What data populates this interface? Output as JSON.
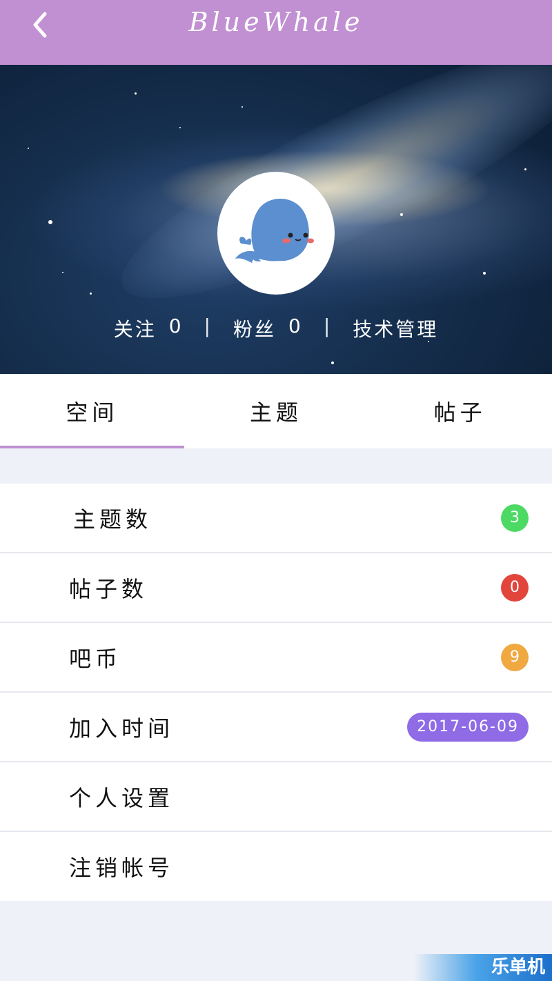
{
  "header": {
    "title": "BlueWhale",
    "back_icon": "chevron-left-icon"
  },
  "profile": {
    "follow_label": "关注",
    "follow_count": "0",
    "fans_label": "粉丝",
    "fans_count": "0",
    "separator": "|",
    "role": "技术管理"
  },
  "tabs": [
    {
      "label": "空间",
      "active": true
    },
    {
      "label": "主题",
      "active": false
    },
    {
      "label": "帖子",
      "active": false
    }
  ],
  "list": [
    {
      "label": "主题数",
      "badge": "3",
      "badge_color": "#4cd964"
    },
    {
      "label": "帖子数",
      "badge": "0",
      "badge_color": "#e2453c"
    },
    {
      "label": "吧币",
      "badge": "9",
      "badge_color": "#f0a841"
    },
    {
      "label": "加入时间",
      "badge": "2017-06-09",
      "badge_color": "#8f6be6"
    },
    {
      "label": "个人设置"
    },
    {
      "label": "注销帐号"
    }
  ],
  "colors": {
    "accent": "#c190d2",
    "background": "#eef1f7"
  },
  "watermark": "乐单机"
}
